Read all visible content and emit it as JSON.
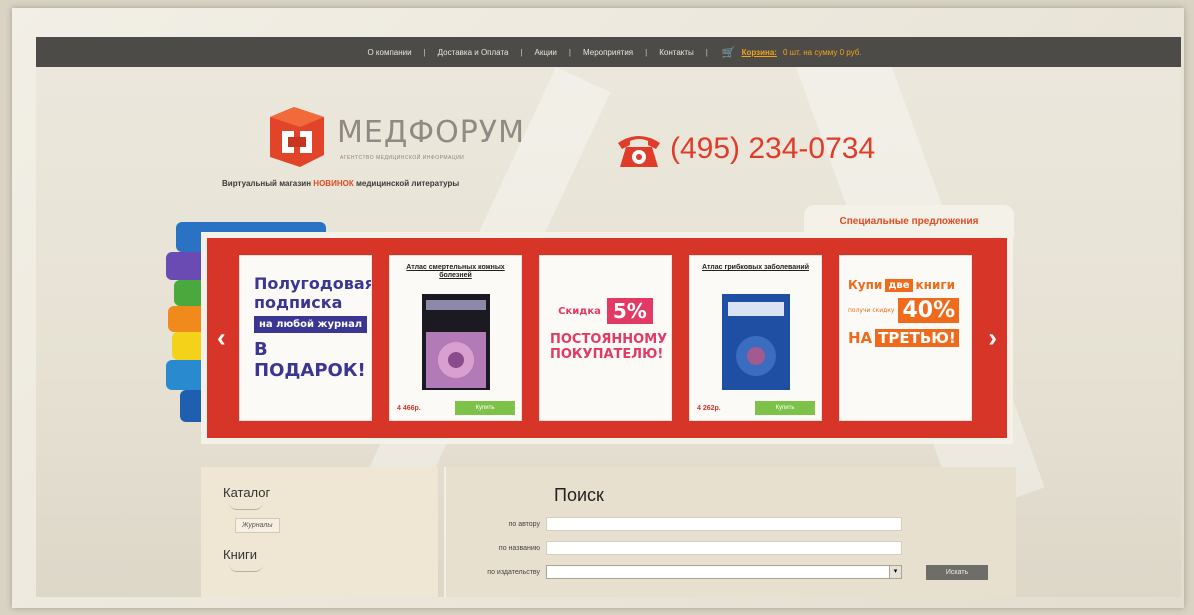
{
  "nav": {
    "items": [
      "О компании",
      "Доставка и Оплата",
      "Акции",
      "Мероприятия",
      "Контакты"
    ],
    "cart_label": "Корзина:",
    "cart_info": "0 шт. на сумму 0 руб."
  },
  "brand": {
    "name": "МЕДФОРУМ",
    "subtitle": "АГЕНТСТВО МЕДИЦИНСКОЙ ИНФОРМАЦИИ",
    "tagline_before": "Виртуальный магазин",
    "tagline_highlight": "НОВИНОК",
    "tagline_after": "медицинской литературы"
  },
  "phone": "(495) 234-0734",
  "special_tab": "Специальные предложения",
  "slider": {
    "prev_arrow": "‹",
    "next_arrow": "›",
    "promo_subscription": {
      "line1": "Полугодовая",
      "line2": "подписка",
      "band": "на любой журнал",
      "line3": "В ПОДАРОК!"
    },
    "book1": {
      "title": "Атлас смертельных кожных болезней",
      "price": "4 466р.",
      "button": "Купить"
    },
    "promo_discount": {
      "label": "Скидка",
      "percent": "5%",
      "line1": "ПОСТОЯННОМУ",
      "line2": "ПОКУПАТЕЛЮ!"
    },
    "book2": {
      "title": "Атлас грибковых заболеваний",
      "price": "4 262р.",
      "button": "Купить"
    },
    "promo_third": {
      "buy": "Купи",
      "two": "две",
      "books": "книги",
      "get": "получи скидку",
      "percent": "40%",
      "on": "НА",
      "third": "ТРЕТЬЮ!"
    }
  },
  "catalog": {
    "title": "Каталог",
    "journals": "Журналы",
    "books": "Книги"
  },
  "search": {
    "title": "Поиск",
    "by_author": "по автору",
    "by_title": "по названию",
    "by_publisher": "по издательству",
    "button": "Искать"
  },
  "colors": {
    "accent_red": "#d63528",
    "nav_bg": "#4d4b47",
    "orange": "#f2a21b"
  }
}
